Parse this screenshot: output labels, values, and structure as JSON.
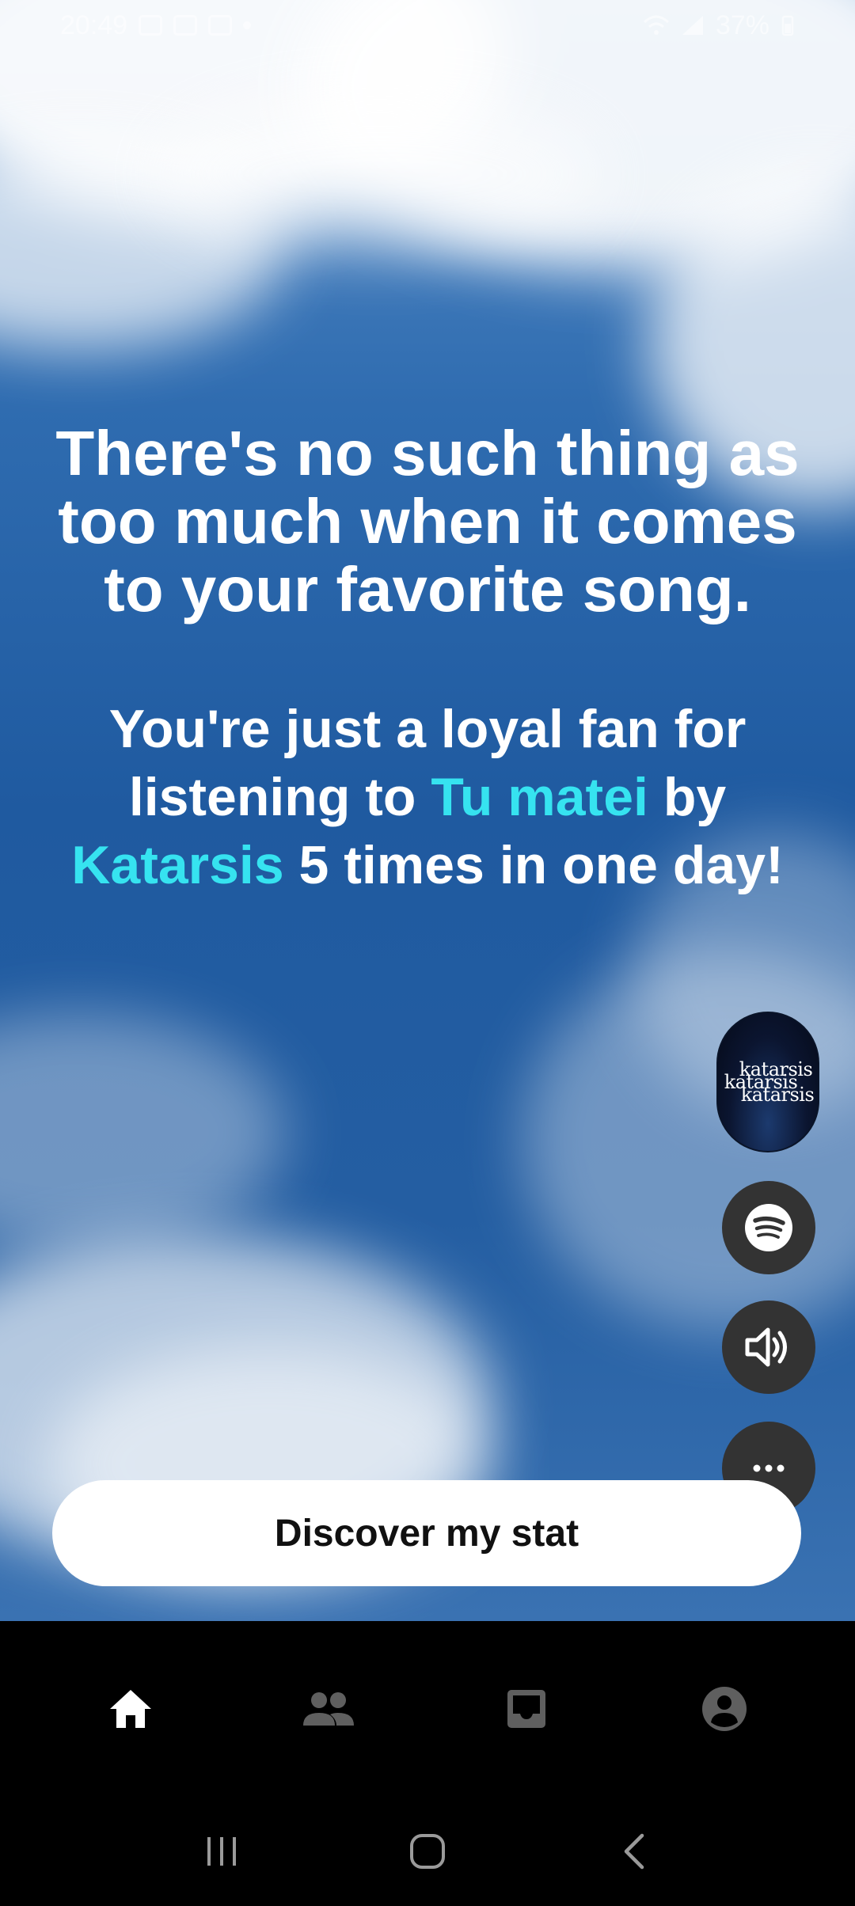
{
  "status_bar": {
    "time": "20:49",
    "battery": "37%"
  },
  "headline": "There's no such thing as too much when it comes to your favorite song.",
  "subline": {
    "part1": "You're just a loyal fan for listening to ",
    "song": "Tu matei",
    "part2": " by ",
    "artist": "Katarsis",
    "part3": " 5 times in one day!"
  },
  "album_art": {
    "line1": "katarsis",
    "line2": "katarsis",
    "line3": "katarsis"
  },
  "actions": {
    "spotify_icon": "spotify-icon",
    "sound_icon": "volume-icon",
    "more_icon": "more-horizontal-icon"
  },
  "discover_button": "Discover my stat",
  "bottom_nav": {
    "items": [
      {
        "icon": "home-icon",
        "active": true
      },
      {
        "icon": "friends-icon",
        "active": false
      },
      {
        "icon": "inbox-icon",
        "active": false
      },
      {
        "icon": "profile-icon",
        "active": false
      }
    ]
  },
  "colors": {
    "accent": "#36e3f0",
    "button_bg": "#ffffff",
    "side_button_bg": "#333333"
  }
}
